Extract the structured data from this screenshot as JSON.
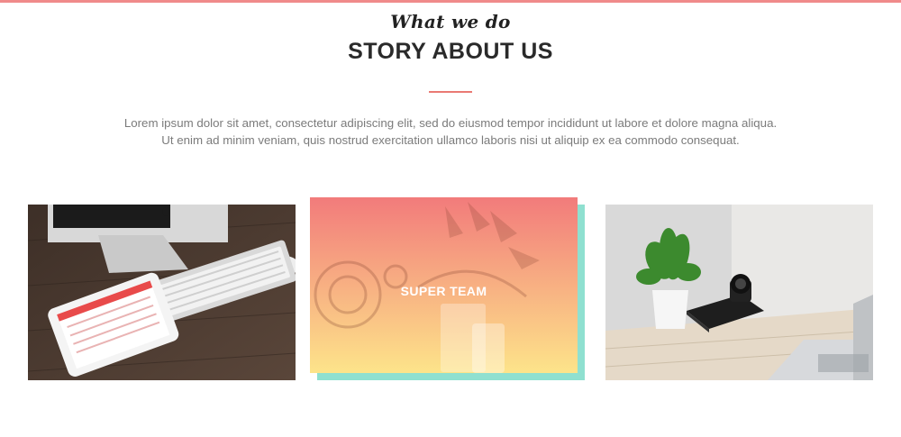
{
  "section": {
    "script_title": "What we do",
    "title": "STORY ABOUT US",
    "description_line1": "Lorem ipsum dolor sit amet, consectetur adipiscing elit, sed do eiusmod tempor incididunt ut labore et dolore magna aliqua.",
    "description_line2": "Ut enim ad minim veniam, quis nostrud exercitation ullamco laboris nisi ut aliquip ex ea commodo consequat."
  },
  "cards": [
    {
      "image": "desk-imac-tablet-keyboard"
    },
    {
      "image": "headphones-notebook-phone",
      "label": "SUPER TEAM"
    },
    {
      "image": "plant-camera-laptop"
    }
  ],
  "colors": {
    "accent": "#ea7a73",
    "overlay_top": "#f27b7b",
    "overlay_bottom": "#fde48a",
    "shadow_block": "#8fe0d0"
  }
}
